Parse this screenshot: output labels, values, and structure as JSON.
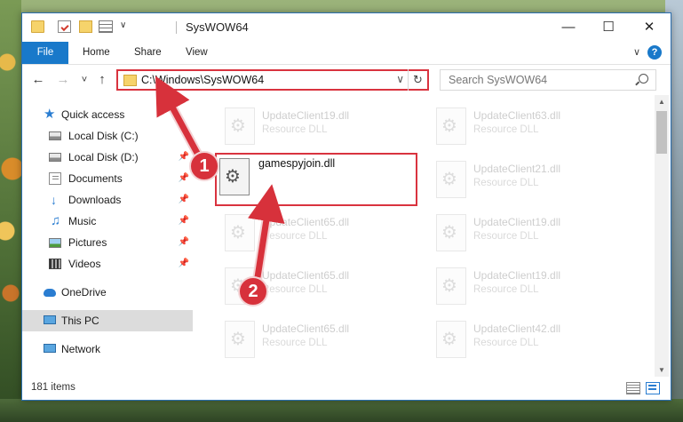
{
  "window": {
    "title": "SysWOW64",
    "controls": {
      "minimize": "—",
      "maximize": "☐",
      "close": "✕"
    }
  },
  "ribbon": {
    "tabs": [
      "File",
      "Home",
      "Share",
      "View"
    ],
    "expand": "∨",
    "help": "?"
  },
  "nav": {
    "back": "←",
    "forward": "→",
    "recent": "˅",
    "up": "↑",
    "address": "C:\\Windows\\SysWOW64",
    "address_chevron": "∨",
    "refresh": "↻",
    "search_placeholder": "Search SysWOW64"
  },
  "sidebar": {
    "items": [
      {
        "label": "Quick access",
        "pinned": false
      },
      {
        "label": "Local Disk (C:)",
        "pinned": true
      },
      {
        "label": "Local Disk (D:)",
        "pinned": true
      },
      {
        "label": "Documents",
        "pinned": true
      },
      {
        "label": "Downloads",
        "pinned": true
      },
      {
        "label": "Music",
        "pinned": true
      },
      {
        "label": "Pictures",
        "pinned": true
      },
      {
        "label": "Videos",
        "pinned": true
      },
      {
        "label": "OneDrive",
        "pinned": false
      },
      {
        "label": "This PC",
        "pinned": false,
        "selected": true
      },
      {
        "label": "Network",
        "pinned": false
      }
    ],
    "pin_glyph": "📌"
  },
  "files": {
    "items": [
      {
        "name": "UpdateClient19.dll",
        "type": "Resource DLL"
      },
      {
        "name": "UpdateClient63.dll",
        "type": "Resource DLL"
      },
      {
        "name": "UpdateClient21.dll",
        "type": "Resource DLL"
      },
      {
        "name": "UpdateClient65.dll",
        "type": "Resource DLL"
      },
      {
        "name": "UpdateClient19.dll",
        "type": "Resource DLL"
      },
      {
        "name": "UpdateClient65.dll",
        "type": "Resource DLL"
      },
      {
        "name": "UpdateClient19.dll",
        "type": "Resource DLL"
      },
      {
        "name": "UpdateClient65.dll",
        "type": "Resource DLL"
      },
      {
        "name": "UpdateClient42.dll",
        "type": "Resource DLL"
      }
    ],
    "highlighted": {
      "name": "gamespyjoin.dll"
    }
  },
  "scrollbar": {
    "up": "▲",
    "down": "▼"
  },
  "status": {
    "item_count": "181 items"
  },
  "annotations": {
    "step1": "1",
    "step2": "2",
    "color": "#d7313b"
  }
}
